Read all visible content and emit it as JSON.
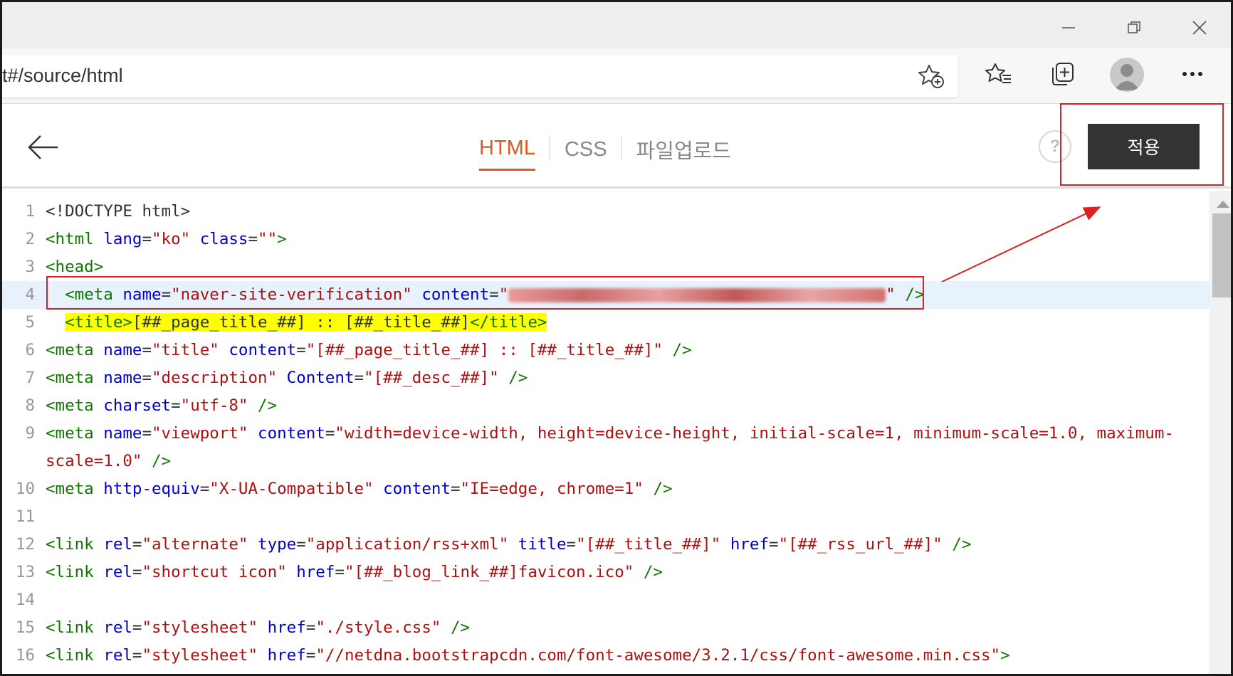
{
  "browser": {
    "address": "t#/source/html",
    "icons": {
      "favorite_add": "star-add-icon",
      "favorites": "favorites-list-icon",
      "collections": "collections-icon",
      "profile": "avatar",
      "menu": "ellipsis-icon"
    },
    "window_controls": [
      "minimize-icon",
      "restore-icon",
      "close-icon"
    ]
  },
  "editor": {
    "tabs": [
      {
        "label": "HTML",
        "active": true
      },
      {
        "label": "CSS",
        "active": false
      },
      {
        "label": "파일업로드",
        "active": false
      }
    ],
    "help_label": "?",
    "apply_label": "적용",
    "colors": {
      "accent": "#e0571f",
      "apply_bg": "#333333",
      "annotation": "#e02020",
      "title_highlight": "#ffff00"
    }
  },
  "code": {
    "current_line": 4,
    "lines": [
      {
        "n": "1",
        "segments": [
          [
            "t-doc",
            "<!DOCTYPE html>"
          ]
        ]
      },
      {
        "n": "2",
        "segments": [
          [
            "t-tag",
            "<html "
          ],
          [
            "t-attr",
            "lang"
          ],
          [
            "t-plain",
            "="
          ],
          [
            "t-str",
            "\"ko\""
          ],
          [
            "t-plain",
            " "
          ],
          [
            "t-attr",
            "class"
          ],
          [
            "t-plain",
            "="
          ],
          [
            "t-str",
            "\"\""
          ],
          [
            "t-tag",
            ">"
          ]
        ]
      },
      {
        "n": "3",
        "segments": [
          [
            "t-tag",
            "<head>"
          ]
        ]
      },
      {
        "n": "4",
        "segments": [
          [
            "t-plain",
            "  "
          ],
          [
            "t-tag",
            "<meta "
          ],
          [
            "t-attr",
            "name"
          ],
          [
            "t-plain",
            "="
          ],
          [
            "t-str",
            "\"naver-site-verification\""
          ],
          [
            "t-plain",
            " "
          ],
          [
            "t-attr",
            "content"
          ],
          [
            "t-plain",
            "="
          ],
          [
            "t-str",
            "\""
          ],
          [
            "blur",
            ""
          ],
          [
            "t-str",
            "\""
          ],
          [
            "t-plain",
            " "
          ],
          [
            "t-tag",
            "/>"
          ]
        ]
      },
      {
        "n": "5",
        "segments": [
          [
            "t-plain",
            "  "
          ],
          [
            "hl:t-tag",
            "<title>"
          ],
          [
            "hl:t-plain",
            "[##_page_title_##] :: [##_title_##]"
          ],
          [
            "hl:t-tag",
            "</title>"
          ]
        ]
      },
      {
        "n": "6",
        "segments": [
          [
            "t-tag",
            "<meta "
          ],
          [
            "t-attr",
            "name"
          ],
          [
            "t-plain",
            "="
          ],
          [
            "t-str",
            "\"title\""
          ],
          [
            "t-plain",
            " "
          ],
          [
            "t-attr",
            "content"
          ],
          [
            "t-plain",
            "="
          ],
          [
            "t-str",
            "\"[##_page_title_##] :: [##_title_##]\""
          ],
          [
            "t-plain",
            " "
          ],
          [
            "t-tag",
            "/>"
          ]
        ]
      },
      {
        "n": "7",
        "segments": [
          [
            "t-tag",
            "<meta "
          ],
          [
            "t-attr",
            "name"
          ],
          [
            "t-plain",
            "="
          ],
          [
            "t-str",
            "\"description\""
          ],
          [
            "t-plain",
            " "
          ],
          [
            "t-attr",
            "Content"
          ],
          [
            "t-plain",
            "="
          ],
          [
            "t-str",
            "\"[##_desc_##]\""
          ],
          [
            "t-plain",
            " "
          ],
          [
            "t-tag",
            "/>"
          ]
        ]
      },
      {
        "n": "8",
        "segments": [
          [
            "t-tag",
            "<meta "
          ],
          [
            "t-attr",
            "charset"
          ],
          [
            "t-plain",
            "="
          ],
          [
            "t-str",
            "\"utf-8\""
          ],
          [
            "t-plain",
            " "
          ],
          [
            "t-tag",
            "/>"
          ]
        ]
      },
      {
        "n": "9",
        "segments": [
          [
            "t-tag",
            "<meta "
          ],
          [
            "t-attr",
            "name"
          ],
          [
            "t-plain",
            "="
          ],
          [
            "t-str",
            "\"viewport\""
          ],
          [
            "t-plain",
            " "
          ],
          [
            "t-attr",
            "content"
          ],
          [
            "t-plain",
            "="
          ],
          [
            "t-str",
            "\"width=device-width, height=device-height, initial-scale=1, minimum-scale=1.0, maximum-"
          ]
        ]
      },
      {
        "n": "",
        "segments": [
          [
            "t-str",
            "scale=1.0\""
          ],
          [
            "t-plain",
            " "
          ],
          [
            "t-tag",
            "/>"
          ]
        ]
      },
      {
        "n": "10",
        "segments": [
          [
            "t-tag",
            "<meta "
          ],
          [
            "t-attr",
            "http-equiv"
          ],
          [
            "t-plain",
            "="
          ],
          [
            "t-str",
            "\"X-UA-Compatible\""
          ],
          [
            "t-plain",
            " "
          ],
          [
            "t-attr",
            "content"
          ],
          [
            "t-plain",
            "="
          ],
          [
            "t-str",
            "\"IE=edge, chrome=1\""
          ],
          [
            "t-plain",
            " "
          ],
          [
            "t-tag",
            "/>"
          ]
        ]
      },
      {
        "n": "11",
        "segments": []
      },
      {
        "n": "12",
        "segments": [
          [
            "t-tag",
            "<link "
          ],
          [
            "t-attr",
            "rel"
          ],
          [
            "t-plain",
            "="
          ],
          [
            "t-str",
            "\"alternate\""
          ],
          [
            "t-plain",
            " "
          ],
          [
            "t-attr",
            "type"
          ],
          [
            "t-plain",
            "="
          ],
          [
            "t-str",
            "\"application/rss+xml\""
          ],
          [
            "t-plain",
            " "
          ],
          [
            "t-attr",
            "title"
          ],
          [
            "t-plain",
            "="
          ],
          [
            "t-str",
            "\"[##_title_##]\""
          ],
          [
            "t-plain",
            " "
          ],
          [
            "t-attr",
            "href"
          ],
          [
            "t-plain",
            "="
          ],
          [
            "t-str",
            "\"[##_rss_url_##]\""
          ],
          [
            "t-plain",
            " "
          ],
          [
            "t-tag",
            "/>"
          ]
        ]
      },
      {
        "n": "13",
        "segments": [
          [
            "t-tag",
            "<link "
          ],
          [
            "t-attr",
            "rel"
          ],
          [
            "t-plain",
            "="
          ],
          [
            "t-str",
            "\"shortcut icon\""
          ],
          [
            "t-plain",
            " "
          ],
          [
            "t-attr",
            "href"
          ],
          [
            "t-plain",
            "="
          ],
          [
            "t-str",
            "\"[##_blog_link_##]favicon.ico\""
          ],
          [
            "t-plain",
            " "
          ],
          [
            "t-tag",
            "/>"
          ]
        ]
      },
      {
        "n": "14",
        "segments": []
      },
      {
        "n": "15",
        "segments": [
          [
            "t-tag",
            "<link "
          ],
          [
            "t-attr",
            "rel"
          ],
          [
            "t-plain",
            "="
          ],
          [
            "t-str",
            "\"stylesheet\""
          ],
          [
            "t-plain",
            " "
          ],
          [
            "t-attr",
            "href"
          ],
          [
            "t-plain",
            "="
          ],
          [
            "t-str",
            "\"./style.css\""
          ],
          [
            "t-plain",
            " "
          ],
          [
            "t-tag",
            "/>"
          ]
        ]
      },
      {
        "n": "16",
        "segments": [
          [
            "t-tag",
            "<link "
          ],
          [
            "t-attr",
            "rel"
          ],
          [
            "t-plain",
            "="
          ],
          [
            "t-str",
            "\"stylesheet\""
          ],
          [
            "t-plain",
            " "
          ],
          [
            "t-attr",
            "href"
          ],
          [
            "t-plain",
            "="
          ],
          [
            "t-str",
            "\"//netdna.bootstrapcdn.com/font-awesome/3.2.1/css/font-awesome.min.css\""
          ],
          [
            "t-tag",
            ">"
          ]
        ]
      }
    ]
  }
}
